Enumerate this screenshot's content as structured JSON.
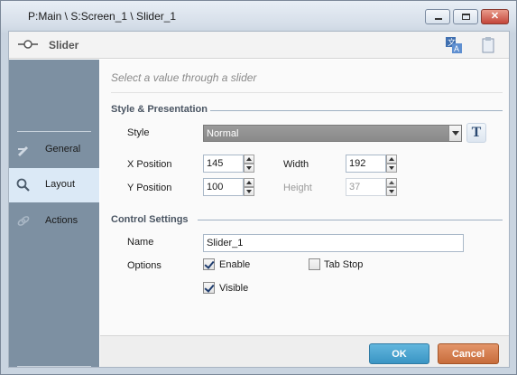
{
  "window": {
    "title": "P:Main \\ S:Screen_1 \\ Slider_1"
  },
  "header": {
    "title": "Slider",
    "icons": [
      "slider-icon",
      "translate-icon",
      "notes-icon"
    ]
  },
  "sidebar": {
    "items": [
      {
        "label": "General",
        "icon": "pencil-icon",
        "active": false
      },
      {
        "label": "Layout",
        "icon": "magnifier-icon",
        "active": true
      },
      {
        "label": "Actions",
        "icon": "link-icon",
        "active": false
      }
    ]
  },
  "content": {
    "hint": "Select a value through a slider",
    "style_section": {
      "title": "Style & Presentation",
      "style_label": "Style",
      "style_value": "Normal",
      "text_button": "T",
      "x_label": "X Position",
      "x_value": "145",
      "width_label": "Width",
      "width_value": "192",
      "y_label": "Y Position",
      "y_value": "100",
      "height_label": "Height",
      "height_value": "37"
    },
    "control_section": {
      "title": "Control Settings",
      "name_label": "Name",
      "name_value": "Slider_1",
      "options_label": "Options",
      "enable_label": "Enable",
      "enable_checked": true,
      "tabstop_label": "Tab Stop",
      "tabstop_checked": false,
      "visible_label": "Visible",
      "visible_checked": true
    }
  },
  "footer": {
    "ok_label": "OK",
    "cancel_label": "Cancel"
  },
  "colors": {
    "sidebar": "#7d90a2",
    "ok": "#3a95c4",
    "cancel": "#c76c3b"
  }
}
